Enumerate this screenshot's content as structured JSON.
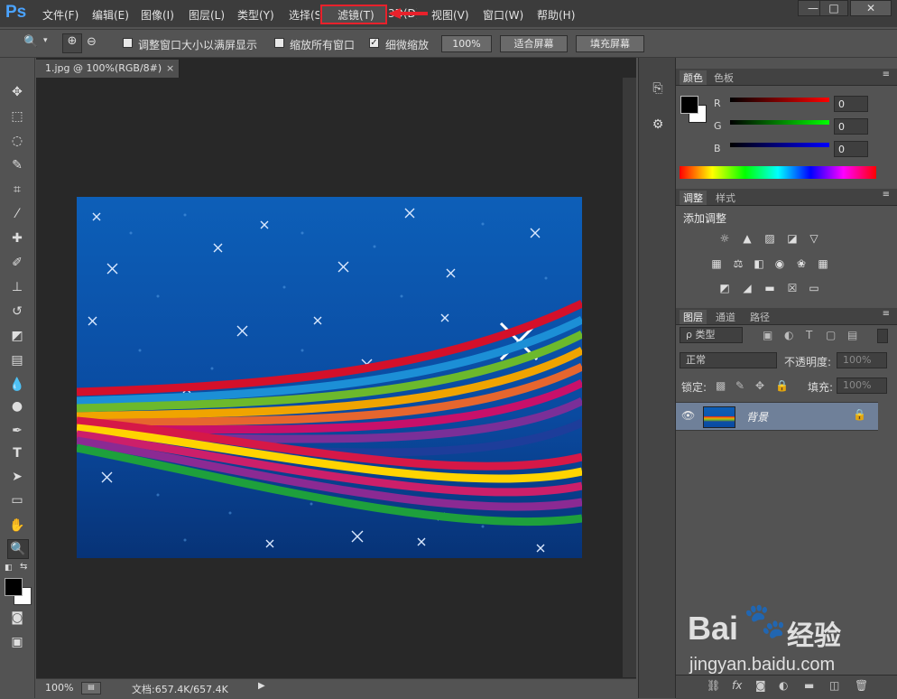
{
  "app": {
    "logo": "Ps",
    "menu": [
      "文件(F)",
      "编辑(E)",
      "图像(I)",
      "图层(L)",
      "类型(Y)",
      "选择(S)",
      "滤镜(T)",
      "3D(D)",
      "视图(V)",
      "窗口(W)",
      "帮助(H)"
    ],
    "highlighted_menu": "滤镜(T)",
    "window_controls": [
      "—",
      "□",
      "✕"
    ]
  },
  "options": {
    "resize_windows": "调整窗口大小以满屏显示",
    "zoom_all_windows": "缩放所有窗口",
    "scrubby_zoom": "细微缩放",
    "scrubby_zoom_checked": true,
    "zoom_pct_button": "100%",
    "fit_screen_button": "适合屏幕",
    "fill_screen_button": "填充屏幕"
  },
  "document": {
    "tab_title": "1.jpg @ 100%(RGB/8#)",
    "tab_close": "×",
    "zoom": "100%",
    "doc_size": "文档:657.4K/657.4K"
  },
  "color_panel": {
    "tabs": [
      "颜色",
      "色板"
    ],
    "labels": [
      "R",
      "G",
      "B"
    ],
    "values": [
      "0",
      "0",
      "0"
    ]
  },
  "adjust_panel": {
    "tabs": [
      "调整",
      "样式"
    ],
    "title": "添加调整"
  },
  "layers_panel": {
    "tabs": [
      "图层",
      "通道",
      "路径"
    ],
    "filter_label": "ρ 类型",
    "blend_mode": "正常",
    "opacity_label": "不透明度:",
    "opacity_value": "100%",
    "lock_label": "锁定:",
    "fill_label": "填充:",
    "fill_value": "100%",
    "layer_name": "背景"
  },
  "watermark": {
    "brand": "Bai",
    "brand2": "经验",
    "url": "jingyan.baidu.com"
  }
}
